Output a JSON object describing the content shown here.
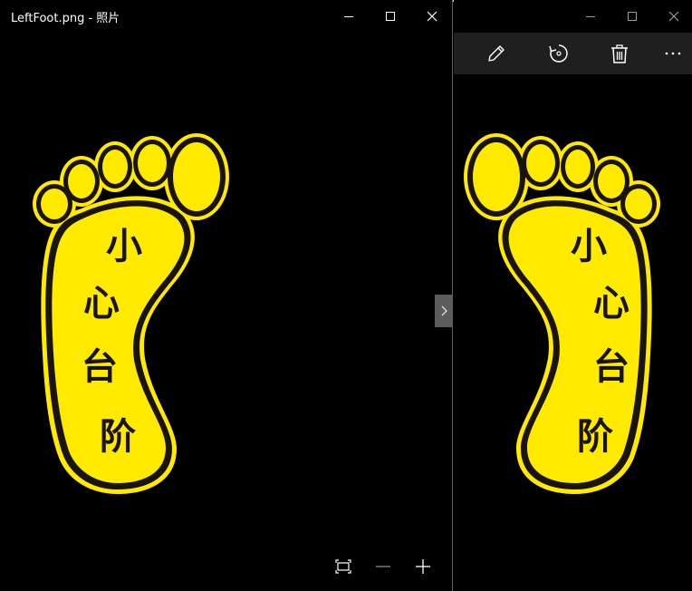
{
  "left_window": {
    "title": "LeftFoot.png - 照片",
    "caption": {
      "minimize_icon": "minimize-icon",
      "maximize_icon": "maximize-icon",
      "close_icon": "close-icon"
    },
    "image": {
      "characters": [
        "小",
        "心",
        "台",
        "阶"
      ],
      "foot_fill": "#FFEA00",
      "foot_outline": "#1A1410",
      "foot_rim": "#FFEA00"
    },
    "next_arrow_icon": "chevron-right-icon",
    "bottom_tools": [
      "fit-to-window-icon",
      "zoom-out-icon",
      "zoom-in-icon"
    ]
  },
  "right_window": {
    "caption": {
      "minimize_icon": "minimize-icon",
      "maximize_icon": "maximize-icon",
      "close_icon": "close-icon"
    },
    "toolbar": [
      "edit-pencil-icon",
      "rotate-icon",
      "delete-icon",
      "more-icon"
    ],
    "image": {
      "characters": [
        "小",
        "心",
        "台",
        "阶"
      ],
      "foot_fill": "#FFEA00",
      "foot_outline": "#1A1410"
    }
  },
  "colors": {
    "background": "#000000",
    "toolbar_bg": "#1F1F1F",
    "window_border": "#2B6CB5",
    "nav_button": "#5C5C5C",
    "icon_color": "#FFFFFF"
  }
}
